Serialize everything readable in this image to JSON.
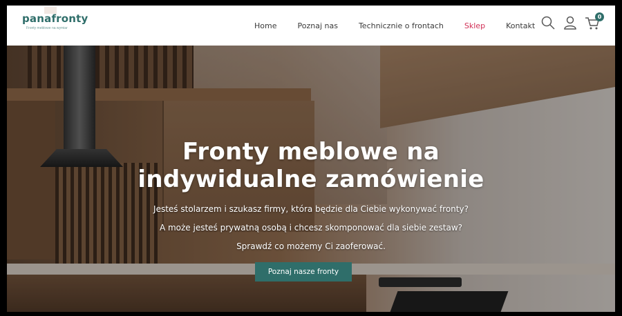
{
  "brand": {
    "name": "panafronty",
    "tagline": "Fronty meblowe na wymiar"
  },
  "nav": {
    "items": [
      {
        "label": "Home",
        "active": false
      },
      {
        "label": "Poznaj nas",
        "active": false
      },
      {
        "label": "Technicznie o frontach",
        "active": false
      },
      {
        "label": "Sklep",
        "active": true
      },
      {
        "label": "Kontakt",
        "active": false
      }
    ]
  },
  "icons": {
    "search": "search-icon",
    "account": "user-icon",
    "cart": "cart-icon",
    "cart_count": "0"
  },
  "hero": {
    "title_line1": "Fronty meblowe na",
    "title_line2": "indywidualne zamówienie",
    "text_line1": "Jesteś stolarzem i szukasz firmy, która będzie dla Ciebie wykonywać fronty?",
    "text_line2": "A może jesteś prywatną osobą i chcesz skomponować dla siebie zestaw?",
    "text_line3": "Sprawdź co możemy Ci zaoferować.",
    "cta_label": "Poznaj nasze fronty"
  },
  "colors": {
    "brand": "#2f6e6a",
    "active_nav": "#d12e55"
  }
}
